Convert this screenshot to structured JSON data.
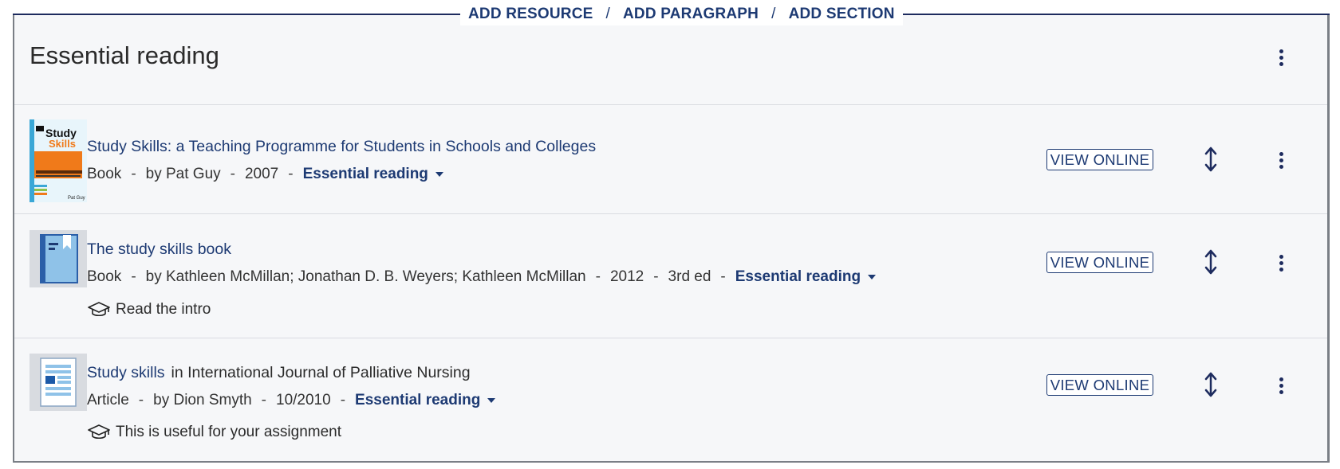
{
  "toolbar": {
    "add_resource": "ADD RESOURCE",
    "add_paragraph": "ADD PARAGRAPH",
    "add_section": "ADD SECTION",
    "separator": "/"
  },
  "section": {
    "title": "Essential reading"
  },
  "items": [
    {
      "title": "Study Skills: a Teaching Programme for Students in Schools and Colleges",
      "type": "Book",
      "author": "by Pat Guy",
      "year": "2007",
      "importance": "Essential reading",
      "button": "VIEW ONLINE",
      "thumbnail": "book-cover-image"
    },
    {
      "title": "The study skills book",
      "type": "Book",
      "author": "by Kathleen McMillan; Jonathan D. B. Weyers; Kathleen McMillan",
      "year": "2012",
      "edition": "3rd ed",
      "importance": "Essential reading",
      "note": "Read the intro",
      "button": "VIEW ONLINE",
      "thumbnail": "book-icon"
    },
    {
      "title": "Study skills",
      "in_text": "in International Journal of Palliative Nursing",
      "type": "Article",
      "author": "by Dion Smyth",
      "year": "10/2010",
      "importance": "Essential reading",
      "note": "This is useful for your assignment",
      "button": "VIEW ONLINE",
      "thumbnail": "article-icon"
    }
  ],
  "cover_text": {
    "line1": "Study",
    "line2": "Skills",
    "author": "Pat Guy"
  },
  "colors": {
    "accent": "#1d3a73",
    "panel": "#f6f7f9"
  }
}
